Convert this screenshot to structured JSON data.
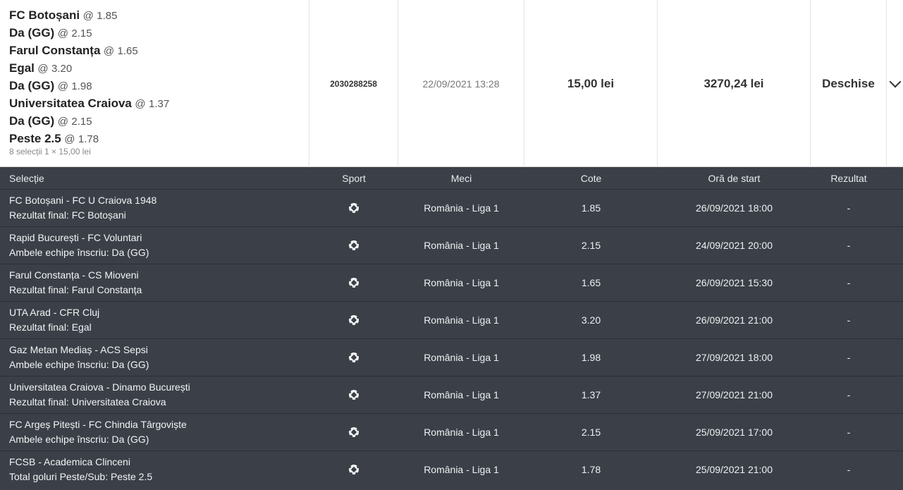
{
  "bet": {
    "selections": [
      {
        "name": "FC Botoșani",
        "at": "@",
        "odd": "1.85"
      },
      {
        "name": "Da (GG)",
        "at": "@",
        "odd": "2.15"
      },
      {
        "name": "Farul Constanța",
        "at": "@",
        "odd": "1.65"
      },
      {
        "name": "Egal",
        "at": "@",
        "odd": "3.20"
      },
      {
        "name": "Da (GG)",
        "at": "@",
        "odd": "1.98"
      },
      {
        "name": "Universitatea Craiova",
        "at": "@",
        "odd": "1.37"
      },
      {
        "name": "Da (GG)",
        "at": "@",
        "odd": "2.15"
      },
      {
        "name": "Peste 2.5",
        "at": "@",
        "odd": "1.78"
      }
    ],
    "meta": "8 selecții 1 × 15,00 lei",
    "ticket_id": "2030288258",
    "placed_at": "22/09/2021 13:28",
    "stake": "15,00 lei",
    "potential_win": "3270,24 lei",
    "status": "Deschise",
    "toggle_icon": "chevron-down-icon"
  },
  "details": {
    "headers": {
      "selection": "Selecție",
      "sport": "Sport",
      "match": "Meci",
      "odds": "Cote",
      "start": "Oră de start",
      "result": "Rezultat"
    },
    "sport_icon": "soccer-ball-icon",
    "rows": [
      {
        "match": "FC Botoșani - FC U Craiova 1948",
        "market": "Rezultat final: FC Botoșani",
        "league": "România - Liga 1",
        "odds": "1.85",
        "start": "26/09/2021 18:00",
        "result": "-"
      },
      {
        "match": "Rapid București - FC Voluntari",
        "market": "Ambele echipe înscriu: Da (GG)",
        "league": "România - Liga 1",
        "odds": "2.15",
        "start": "24/09/2021 20:00",
        "result": "-"
      },
      {
        "match": "Farul Constanța - CS Mioveni",
        "market": "Rezultat final: Farul Constanța",
        "league": "România - Liga 1",
        "odds": "1.65",
        "start": "26/09/2021 15:30",
        "result": "-"
      },
      {
        "match": "UTA Arad - CFR Cluj",
        "market": "Rezultat final: Egal",
        "league": "România - Liga 1",
        "odds": "3.20",
        "start": "26/09/2021 21:00",
        "result": "-"
      },
      {
        "match": "Gaz Metan Mediaș - ACS Sepsi",
        "market": "Ambele echipe înscriu: Da (GG)",
        "league": "România - Liga 1",
        "odds": "1.98",
        "start": "27/09/2021 18:00",
        "result": "-"
      },
      {
        "match": "Universitatea Craiova - Dinamo București",
        "market": "Rezultat final: Universitatea Craiova",
        "league": "România - Liga 1",
        "odds": "1.37",
        "start": "27/09/2021 21:00",
        "result": "-"
      },
      {
        "match": "FC Argeș Pitești - FC Chindia Târgoviște",
        "market": "Ambele echipe înscriu: Da (GG)",
        "league": "România - Liga 1",
        "odds": "2.15",
        "start": "25/09/2021 17:00",
        "result": "-"
      },
      {
        "match": "FCSB - Academica Clinceni",
        "market": "Total goluri Peste/Sub: Peste 2.5",
        "league": "România - Liga 1",
        "odds": "1.78",
        "start": "25/09/2021 21:00",
        "result": "-"
      }
    ]
  }
}
